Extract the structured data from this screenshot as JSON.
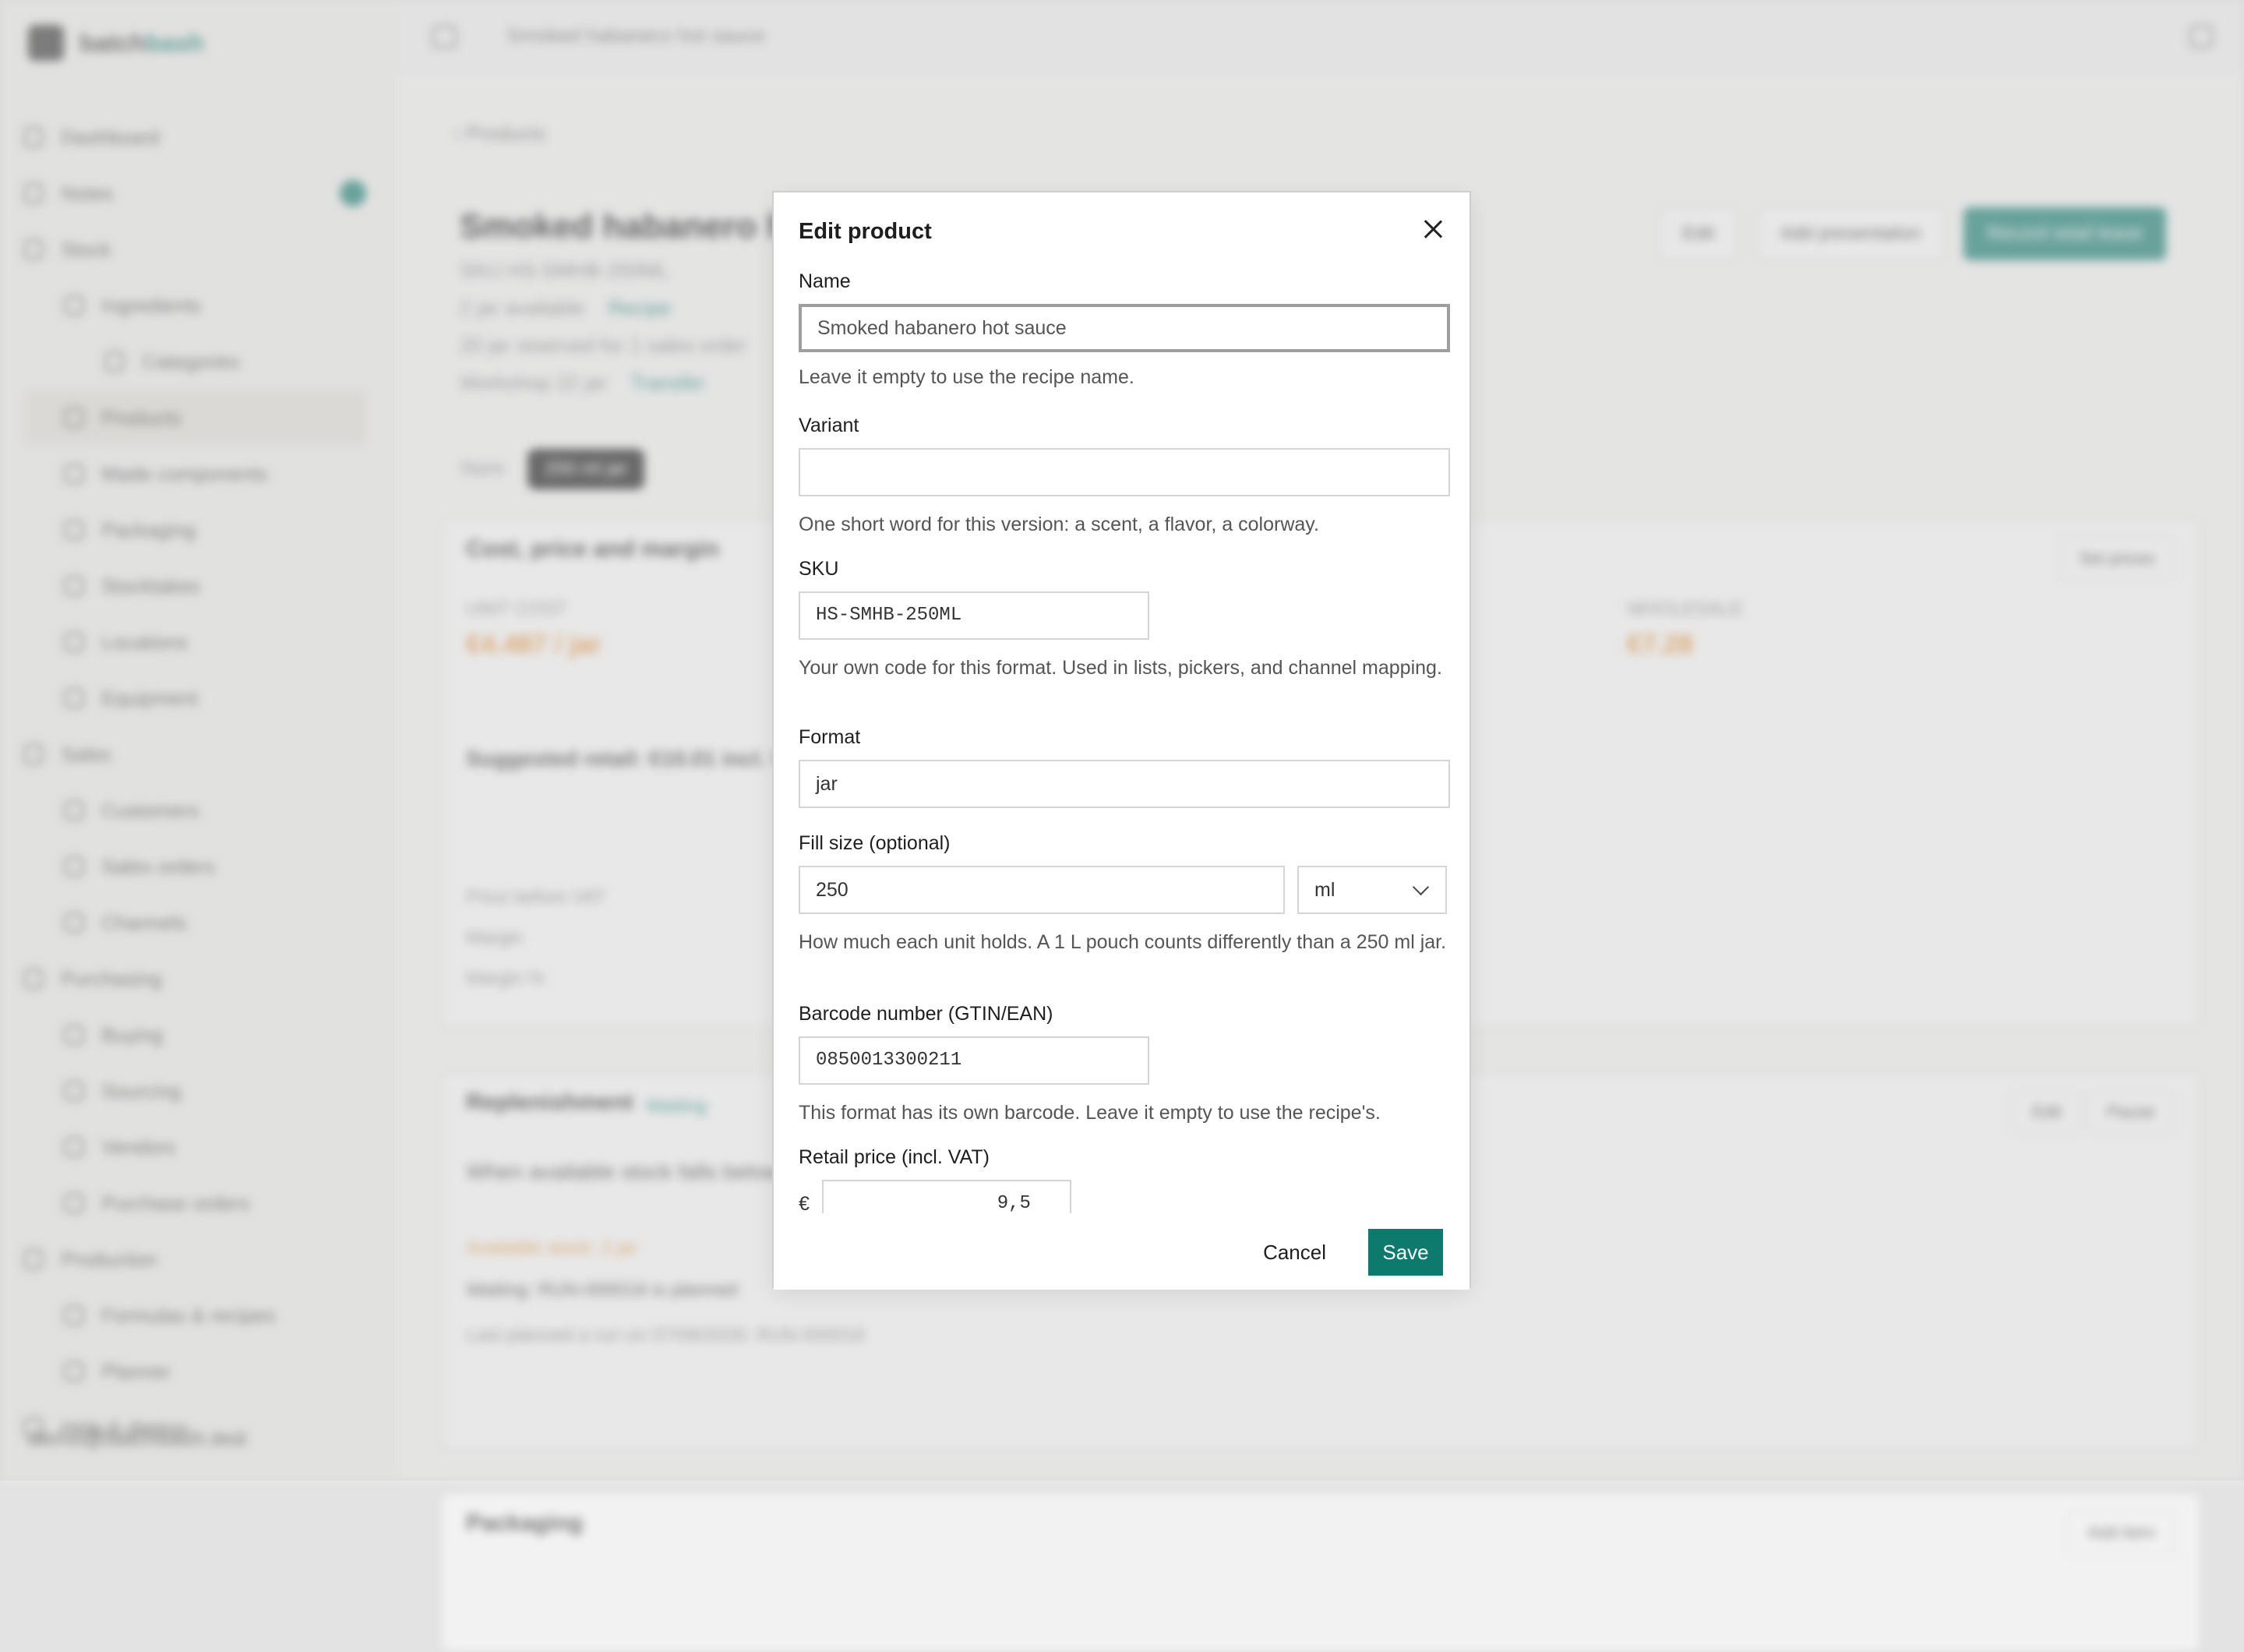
{
  "app": {
    "brand_a": "batch",
    "brand_b": "bash",
    "topbar_breadcrumb": "Smoked habanero hot sauce",
    "back_link": "Products",
    "product_title": "Smoked habanero hot sauce",
    "sku_line": "SKU HS-SMHB-250ML",
    "available_line": "2 jar available",
    "recipe_link": "Recipe",
    "reserved_line": "20 jar reserved for 1 sales order",
    "workshop_line": "Workshop 22 jar",
    "transfer_link": "Transfer",
    "header_buttons": [
      "Edit",
      "Add presentation",
      "Record retail leave"
    ],
    "tabs": [
      "Store",
      "250 ml jar"
    ],
    "cost_card": {
      "title": "Cost, price and margin",
      "set_prices": "Set prices",
      "unit_cost_label": "UNIT COST",
      "unit_cost_value": "€4.487 / jar",
      "wholesale_label": "WHOLESALE",
      "wholesale_value": "€7.28",
      "suggested": "Suggested retail: €10.01 incl. VAT",
      "rows": [
        "Price before VAT",
        "Margin",
        "Margin %"
      ]
    },
    "replenish_card": {
      "title": "Replenishment",
      "status": "Waiting",
      "edit": "Edit",
      "pause": "Pause",
      "line1": "When available stock falls below the trigger, plan a run of Smoked habanero hot sauce",
      "line2": "Available stock: 2 jar",
      "line3": "Waiting: RUN-000016 is planned",
      "line4": "Last planned a run on 07/09/2026: RUN-000016"
    },
    "packaging_card": {
      "title": "Packaging",
      "add": "Add item"
    },
    "nav": [
      "Dashboard",
      "Notes",
      "Stock",
      "Ingredients",
      "Categories",
      "Products",
      "Made components",
      "Packaging",
      "Stocktakes",
      "Locations",
      "Equipment",
      "Sales",
      "Customers",
      "Sales orders",
      "Channels",
      "Purchasing",
      "Buying",
      "Sourcing",
      "Vendors",
      "Purchase orders",
      "Production",
      "Formulas & recipes",
      "Planner",
      "Help & demos"
    ],
    "account": "demo@batchbash.test"
  },
  "modal": {
    "title": "Edit product",
    "name": {
      "label": "Name",
      "value": "Smoked habanero hot sauce",
      "help": "Leave it empty to use the recipe name."
    },
    "variant": {
      "label": "Variant",
      "value": "",
      "help": "One short word for this version: a scent, a flavor, a colorway."
    },
    "sku": {
      "label": "SKU",
      "value": "HS-SMHB-250ML",
      "help": "Your own code for this format. Used in lists, pickers, and channel mapping."
    },
    "format": {
      "label": "Format",
      "value": "jar"
    },
    "fill_size": {
      "label": "Fill size (optional)",
      "value": "250",
      "unit": "ml",
      "help": "How much each unit holds. A 1 L pouch counts differently than a 250 ml jar."
    },
    "barcode": {
      "label": "Barcode number (GTIN/EAN)",
      "value": "0850013300211",
      "help": "This format has its own barcode. Leave it empty to use the recipe's."
    },
    "retail_price": {
      "label": "Retail price (incl. VAT)",
      "currency": "€",
      "value": "9,5"
    },
    "cancel": "Cancel",
    "save": "Save"
  },
  "colors": {
    "accent": "#0e7a6e",
    "warning": "#e58a2c"
  }
}
